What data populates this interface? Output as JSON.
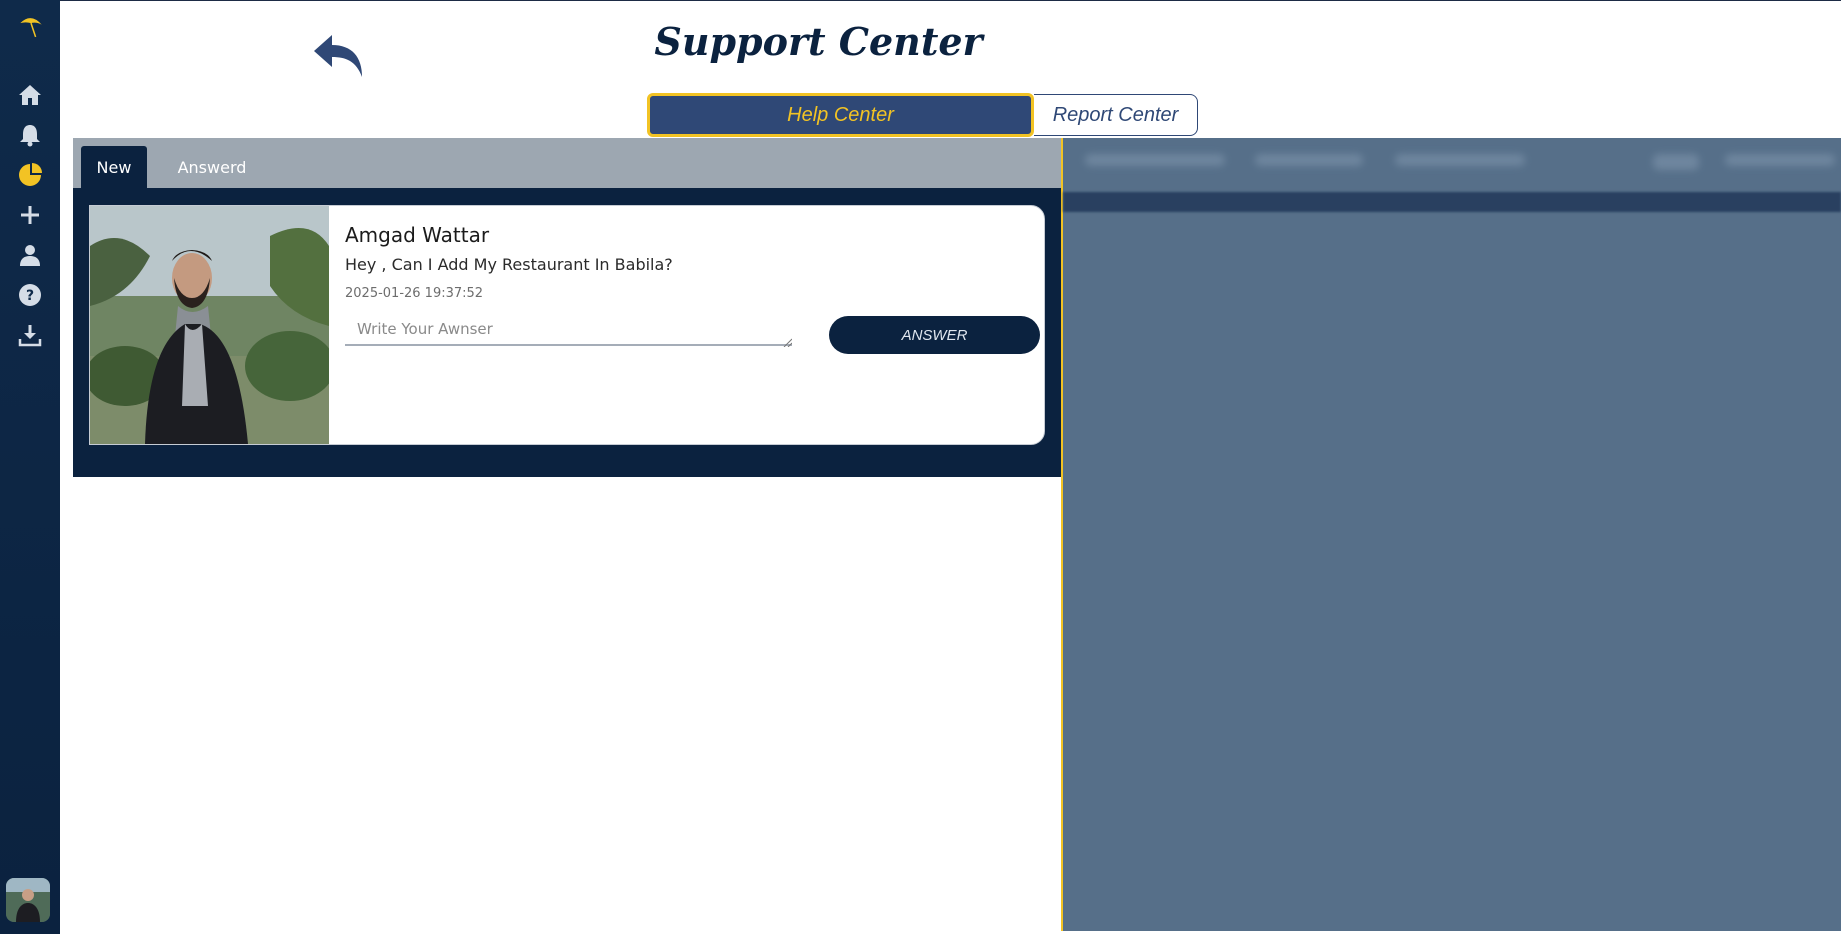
{
  "sidebar": {
    "logo": "umbrella-logo",
    "items": [
      {
        "icon": "home-icon"
      },
      {
        "icon": "bell-icon"
      },
      {
        "icon": "pie-chart-icon",
        "active": true
      },
      {
        "icon": "plus-icon"
      },
      {
        "icon": "user-icon"
      },
      {
        "icon": "help-icon"
      },
      {
        "icon": "download-icon"
      }
    ]
  },
  "header": {
    "title": "Support Center",
    "back_icon": "back-arrow-icon"
  },
  "switch": {
    "help_label": "Help Center",
    "report_label": "Report Center",
    "active": "help"
  },
  "tabs": {
    "new_label": "New",
    "answered_label": "Answerd",
    "active": "new"
  },
  "ticket": {
    "name": "Amgad Wattar",
    "message": "Hey , Can I Add My Restaurant In Babila?",
    "timestamp": "2025-01-26 19:37:52",
    "answer_placeholder": "Write Your Awnser",
    "answer_value": "",
    "answer_button": "ANSWER"
  },
  "colors": {
    "navy": "#0b223f",
    "accent": "#f2c324",
    "switch_active": "#2f4876",
    "overlay": "#566f89"
  }
}
